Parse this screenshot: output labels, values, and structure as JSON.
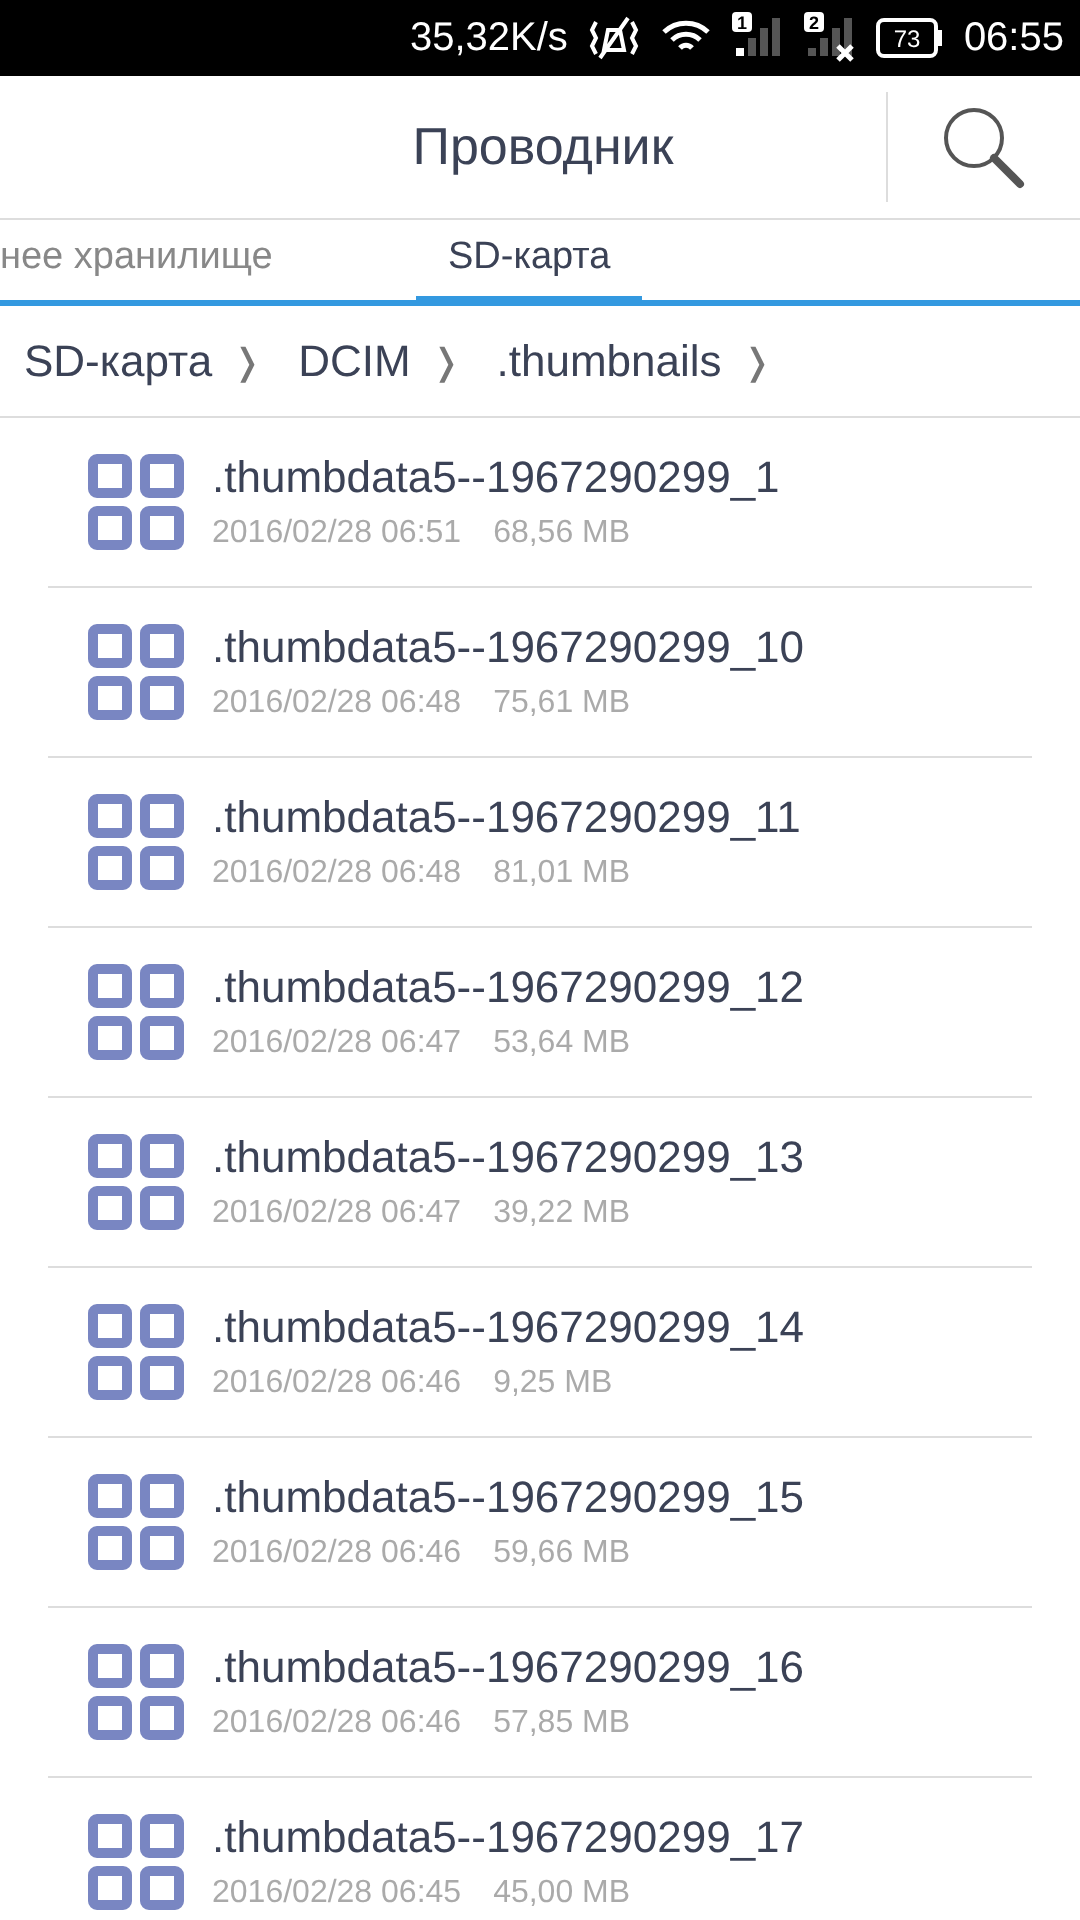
{
  "status_bar": {
    "speed": "35,32K/s",
    "sims": [
      {
        "label": "1",
        "no_service": false
      },
      {
        "label": "2",
        "no_service": true
      }
    ],
    "battery": "73",
    "time": "06:55"
  },
  "header": {
    "title": "Проводник"
  },
  "tabs": [
    {
      "label": "нее хранилище",
      "selected": false
    },
    {
      "label": "SD-карта",
      "selected": true
    }
  ],
  "breadcrumb": [
    {
      "label": "SD-карта",
      "chevron": "❭"
    },
    {
      "label": "DCIM",
      "chevron": "❭"
    },
    {
      "label": ".thumbnails",
      "chevron": "❭"
    }
  ],
  "files": [
    {
      "name": ".thumbdata5--1967290299_1",
      "date": "2016/02/28 06:51",
      "size": "68,56 MB"
    },
    {
      "name": ".thumbdata5--1967290299_10",
      "date": "2016/02/28 06:48",
      "size": "75,61 MB"
    },
    {
      "name": ".thumbdata5--1967290299_11",
      "date": "2016/02/28 06:48",
      "size": "81,01 MB"
    },
    {
      "name": ".thumbdata5--1967290299_12",
      "date": "2016/02/28 06:47",
      "size": "53,64 MB"
    },
    {
      "name": ".thumbdata5--1967290299_13",
      "date": "2016/02/28 06:47",
      "size": "39,22 MB"
    },
    {
      "name": ".thumbdata5--1967290299_14",
      "date": "2016/02/28 06:46",
      "size": "9,25 MB"
    },
    {
      "name": ".thumbdata5--1967290299_15",
      "date": "2016/02/28 06:46",
      "size": "59,66 MB"
    },
    {
      "name": ".thumbdata5--1967290299_16",
      "date": "2016/02/28 06:46",
      "size": "57,85 MB"
    },
    {
      "name": ".thumbdata5--1967290299_17",
      "date": "2016/02/28 06:45",
      "size": "45,00 MB"
    }
  ]
}
